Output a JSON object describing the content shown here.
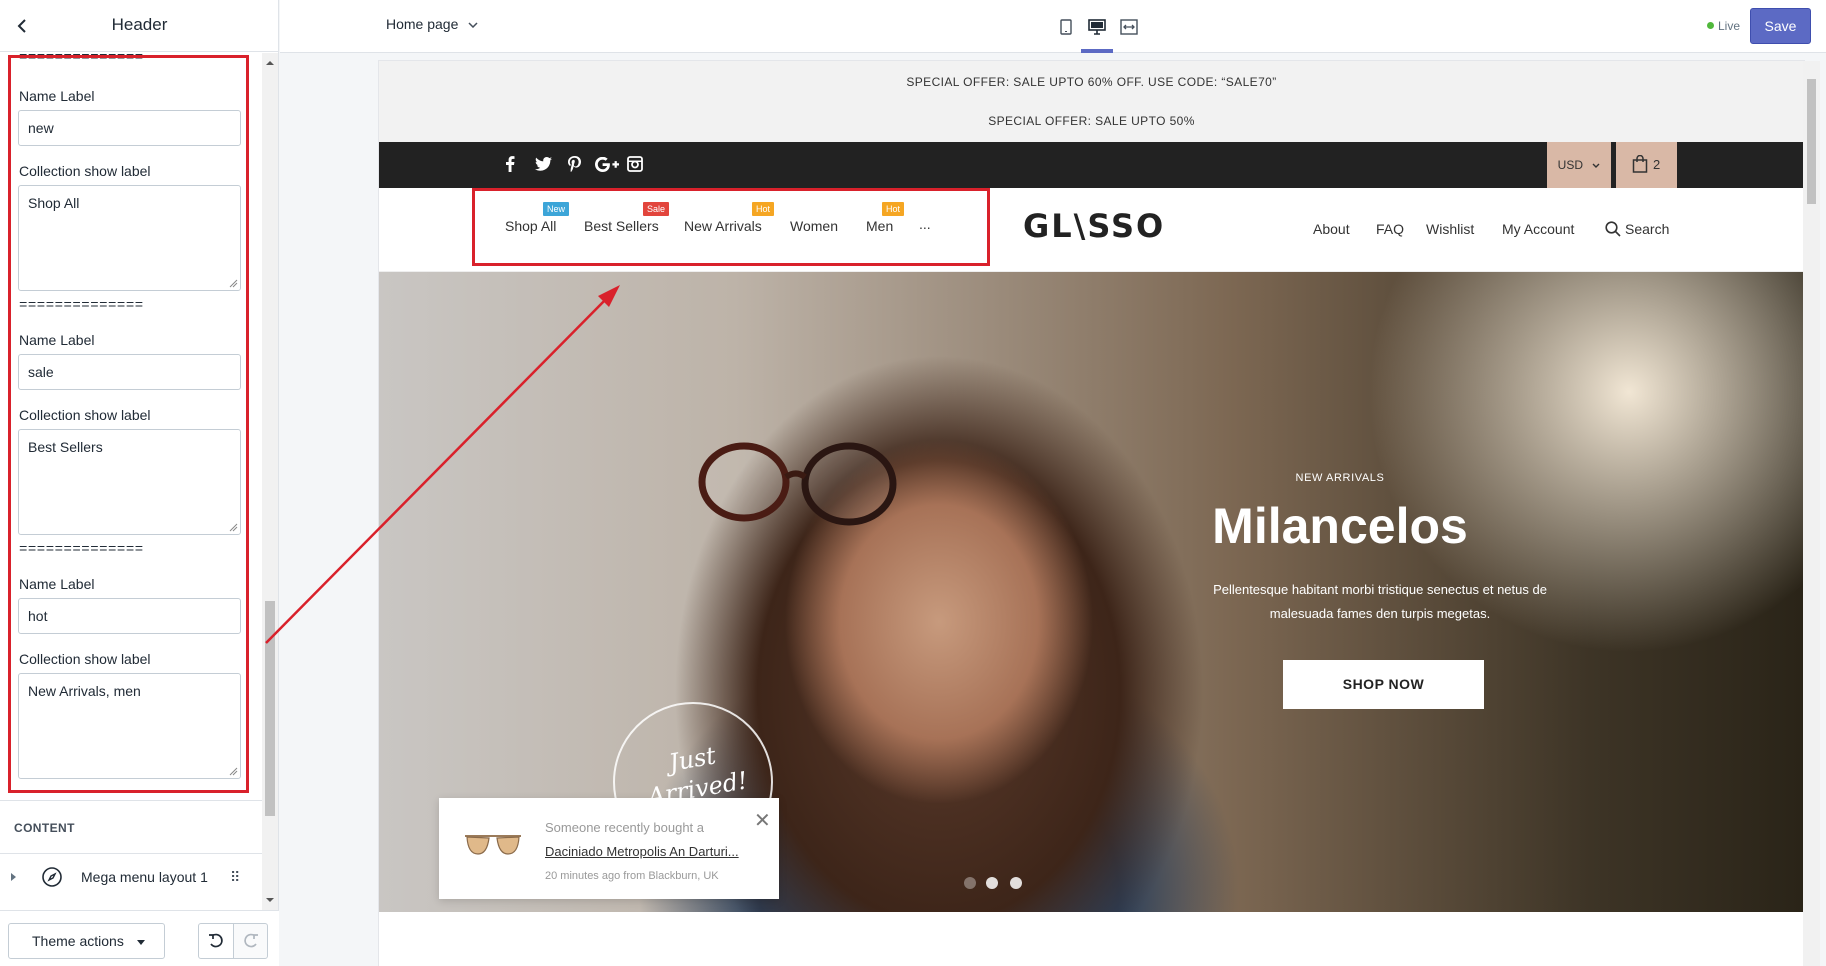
{
  "sidebar": {
    "title": "Header",
    "separator": "==============",
    "groups": [
      {
        "name_label": "Name Label",
        "name_value": "new",
        "collection_label": "Collection show label",
        "collection_value": "Shop All"
      },
      {
        "name_label": "Name Label",
        "name_value": "sale",
        "collection_label": "Collection show label",
        "collection_value": "Best Sellers"
      },
      {
        "name_label": "Name Label",
        "name_value": "hot",
        "collection_label": "Collection show label",
        "collection_value": "New Arrivals, men"
      }
    ],
    "content_section": {
      "title": "CONTENT",
      "item_label": "Mega menu layout 1",
      "drag_glyph": "⠿"
    },
    "footer": {
      "theme_actions": "Theme actions"
    }
  },
  "topbar": {
    "page_select": "Home page",
    "live_label": "Live",
    "save_label": "Save"
  },
  "store": {
    "announcements": [
      "SPECIAL OFFER: SALE UPTO 60% OFF. USE CODE: “SALE70”",
      "SPECIAL OFFER: SALE UPTO 50%"
    ],
    "currency": "USD",
    "cart_count": "2",
    "nav_left": [
      {
        "label": "Shop All",
        "badge": "New",
        "badge_color": "#3ca5d8"
      },
      {
        "label": "Best Sellers",
        "badge": "Sale",
        "badge_color": "#e2453c"
      },
      {
        "label": "New Arrivals",
        "badge": "Hot",
        "badge_color": "#f5a623"
      },
      {
        "label": "Women",
        "badge": "",
        "badge_color": ""
      },
      {
        "label": "Men",
        "badge": "Hot",
        "badge_color": "#f5a623"
      }
    ],
    "nav_more": "...",
    "logo": "GL\\SSO",
    "nav_right": [
      "About",
      "FAQ",
      "Wishlist",
      "My Account",
      "Search"
    ],
    "hero": {
      "subtitle": "NEW ARRIVALS",
      "title": "Milancelos",
      "description": "Pellentesque habitant morbi tristique senectus et netus de malesuada fames den turpis megetas.",
      "button": "SHOP NOW",
      "badge_text_line1": "Just",
      "badge_text_line2": "Arrived!"
    },
    "popup": {
      "line1": "Someone recently bought a",
      "product": "Daciniado Metropolis An Darturi...",
      "meta": "20 minutes ago from Blackburn, UK"
    }
  },
  "colors": {
    "accent": "#5c6ac4",
    "highlight": "#d9212b",
    "live": "#50b83c",
    "currency_bg": "#d9b8a6"
  }
}
